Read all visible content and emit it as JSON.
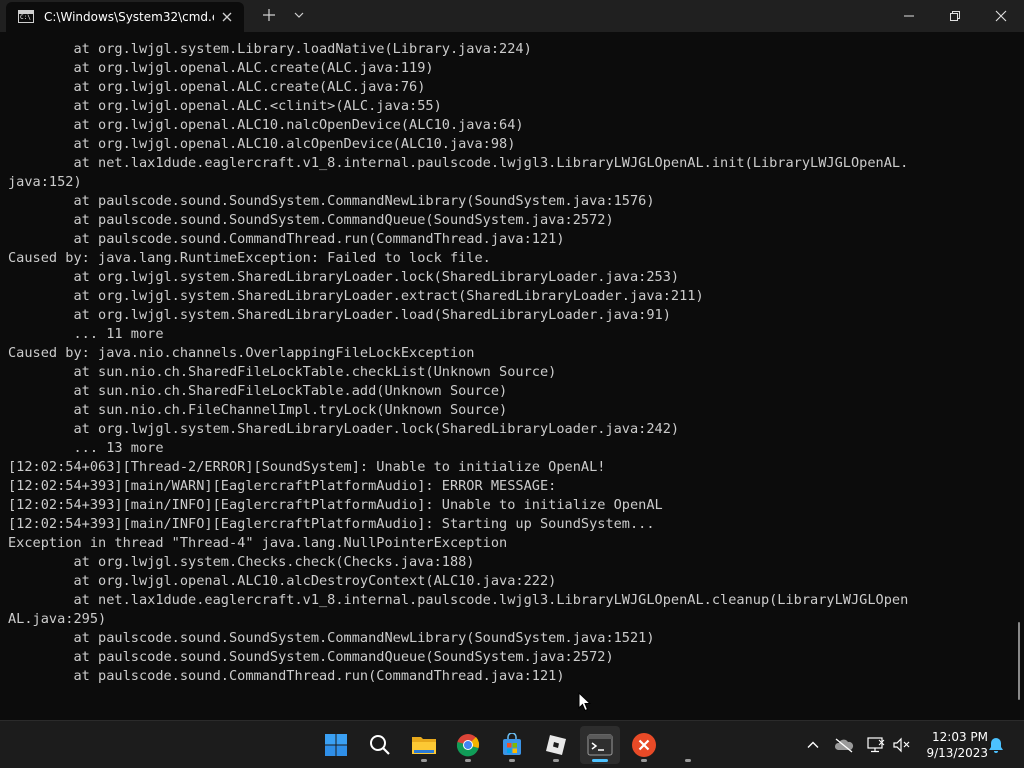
{
  "window": {
    "tab_title": "C:\\Windows\\System32\\cmd.e"
  },
  "console": {
    "lines": [
      "        at org.lwjgl.system.Library.loadNative(Library.java:224)",
      "        at org.lwjgl.openal.ALC.create(ALC.java:119)",
      "        at org.lwjgl.openal.ALC.create(ALC.java:76)",
      "        at org.lwjgl.openal.ALC.<clinit>(ALC.java:55)",
      "        at org.lwjgl.openal.ALC10.nalcOpenDevice(ALC10.java:64)",
      "        at org.lwjgl.openal.ALC10.alcOpenDevice(ALC10.java:98)",
      "        at net.lax1dude.eaglercraft.v1_8.internal.paulscode.lwjgl3.LibraryLWJGLOpenAL.init(LibraryLWJGLOpenAL.",
      "java:152)",
      "        at paulscode.sound.SoundSystem.CommandNewLibrary(SoundSystem.java:1576)",
      "        at paulscode.sound.SoundSystem.CommandQueue(SoundSystem.java:2572)",
      "        at paulscode.sound.CommandThread.run(CommandThread.java:121)",
      "Caused by: java.lang.RuntimeException: Failed to lock file.",
      "        at org.lwjgl.system.SharedLibraryLoader.lock(SharedLibraryLoader.java:253)",
      "        at org.lwjgl.system.SharedLibraryLoader.extract(SharedLibraryLoader.java:211)",
      "        at org.lwjgl.system.SharedLibraryLoader.load(SharedLibraryLoader.java:91)",
      "        ... 11 more",
      "Caused by: java.nio.channels.OverlappingFileLockException",
      "        at sun.nio.ch.SharedFileLockTable.checkList(Unknown Source)",
      "        at sun.nio.ch.SharedFileLockTable.add(Unknown Source)",
      "        at sun.nio.ch.FileChannelImpl.tryLock(Unknown Source)",
      "        at org.lwjgl.system.SharedLibraryLoader.lock(SharedLibraryLoader.java:242)",
      "        ... 13 more",
      "[12:02:54+063][Thread-2/ERROR][SoundSystem]: Unable to initialize OpenAL!",
      "[12:02:54+393][main/WARN][EaglercraftPlatformAudio]: ERROR MESSAGE:",
      "[12:02:54+393][main/INFO][EaglercraftPlatformAudio]: Unable to initialize OpenAL",
      "[12:02:54+393][main/INFO][EaglercraftPlatformAudio]: Starting up SoundSystem...",
      "Exception in thread \"Thread-4\" java.lang.NullPointerException",
      "        at org.lwjgl.system.Checks.check(Checks.java:188)",
      "        at org.lwjgl.openal.ALC10.alcDestroyContext(ALC10.java:222)",
      "        at net.lax1dude.eaglercraft.v1_8.internal.paulscode.lwjgl3.LibraryLWJGLOpenAL.cleanup(LibraryLWJGLOpen",
      "AL.java:295)",
      "        at paulscode.sound.SoundSystem.CommandNewLibrary(SoundSystem.java:1521)",
      "        at paulscode.sound.SoundSystem.CommandQueue(SoundSystem.java:2572)",
      "        at paulscode.sound.CommandThread.run(CommandThread.java:121)"
    ]
  },
  "taskbar": {
    "clock_time": "12:03 PM",
    "clock_date": "9/13/2023",
    "icons": [
      "start-icon",
      "search-icon",
      "file-explorer-icon",
      "chrome-icon",
      "microsoft-store-icon",
      "roblox-icon",
      "terminal-icon",
      "app-close-icon"
    ]
  },
  "colors": {
    "console_bg": "#0c0c0c",
    "console_fg": "#cccccc",
    "titlebar_bg": "#202020",
    "taskbar_bg": "#1c1c1c",
    "accent": "#4cc2ff"
  }
}
